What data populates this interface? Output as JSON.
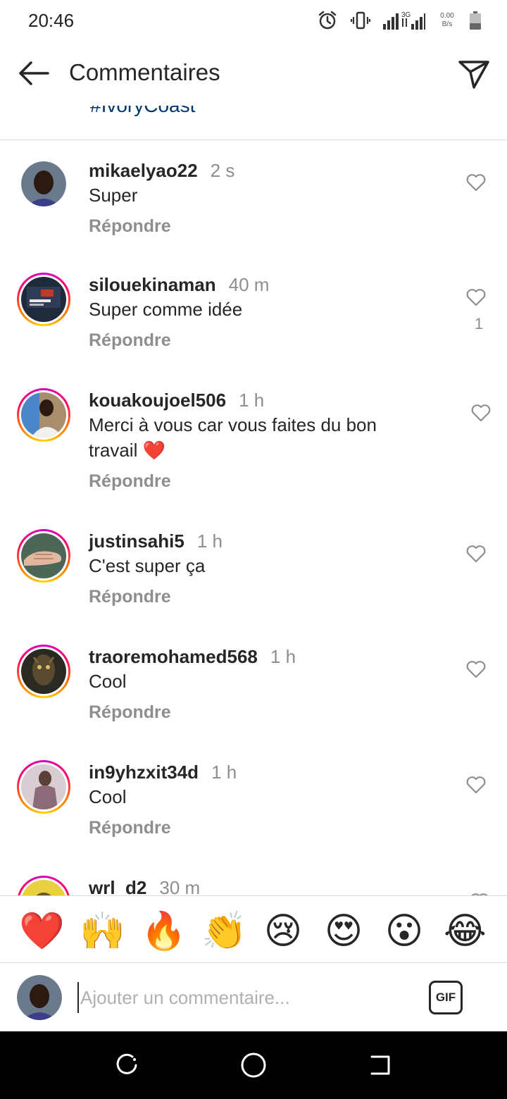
{
  "status": {
    "time": "20:46",
    "network_type": "3G",
    "speed_value": "0.00",
    "speed_unit": "B/s",
    "icons": [
      "alarm-icon",
      "vibrate-icon",
      "signal-icon",
      "signal-icon-2",
      "battery-icon"
    ]
  },
  "header": {
    "title": "Commentaires",
    "back_icon": "arrow-left-icon",
    "share_icon": "send-icon"
  },
  "caption_peek": "#IvoryCoast",
  "comments": [
    {
      "username": "mikaelyao22",
      "time": "2 s",
      "text": "Super",
      "reply": "Répondre",
      "likes": "",
      "story_ring": false
    },
    {
      "username": "silouekinaman",
      "time": "40 m",
      "text": "Super comme idée",
      "reply": "Répondre",
      "likes": "1",
      "story_ring": true
    },
    {
      "username": "kouakoujoel506",
      "time": "1 h",
      "text": "Merci à vous car vous faites du bon travail ❤️",
      "reply": "Répondre",
      "likes": "",
      "story_ring": true
    },
    {
      "username": "justinsahi5",
      "time": "1 h",
      "text": "C'est super ça",
      "reply": "Répondre",
      "likes": "",
      "story_ring": true
    },
    {
      "username": "traoremohamed568",
      "time": "1 h",
      "text": "Cool",
      "reply": "Répondre",
      "likes": "",
      "story_ring": true
    },
    {
      "username": "in9yhzxit34d",
      "time": "1 h",
      "text": "Cool",
      "reply": "Répondre",
      "likes": "",
      "story_ring": true
    },
    {
      "username": "wrl_d2",
      "time": "30 m",
      "text": "",
      "reply": "",
      "likes": "",
      "story_ring": true
    }
  ],
  "emoji_bar": [
    "❤️",
    "🙌",
    "🔥",
    "👏",
    "😢",
    "😍",
    "😮",
    "😂"
  ],
  "composer": {
    "placeholder": "Ajouter un commentaire...",
    "gif_label": "GIF"
  },
  "nav": [
    "recents-button",
    "home-button",
    "back-button"
  ]
}
